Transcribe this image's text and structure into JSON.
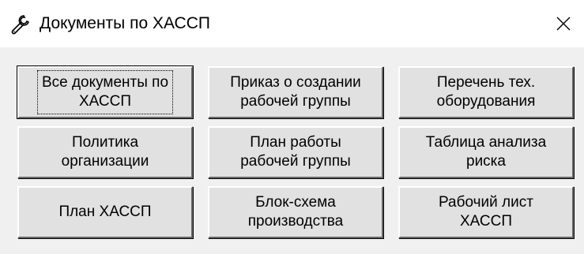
{
  "window": {
    "title": "Документы по ХАССП",
    "title_icon": "wrench-icon",
    "close_icon": "close-icon"
  },
  "buttons": [
    {
      "label": "Все документы по\nХАССП",
      "default": true
    },
    {
      "label": "Приказ о создании\nрабочей группы",
      "default": false
    },
    {
      "label": "Перечень тех.\nоборудования",
      "default": false
    },
    {
      "label": "Политика\nорганизации",
      "default": false
    },
    {
      "label": "План работы\nрабочей группы",
      "default": false
    },
    {
      "label": "Таблица анализа\nриска",
      "default": false
    },
    {
      "label": "План ХАССП",
      "default": false
    },
    {
      "label": "Блок-схема\nпроизводства",
      "default": false
    },
    {
      "label": "Рабочий лист\nХАССП",
      "default": false
    }
  ]
}
